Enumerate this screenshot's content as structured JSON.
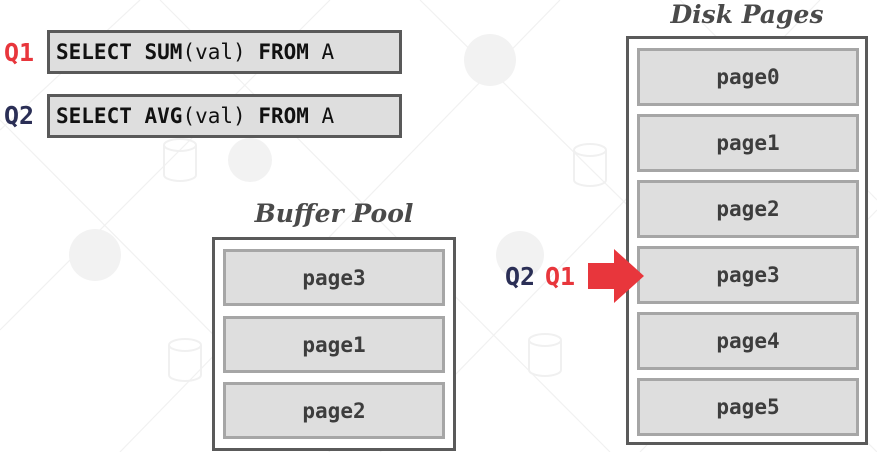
{
  "queries": [
    {
      "id": "Q1",
      "parts": [
        {
          "text": "SELECT",
          "bold": true
        },
        {
          "text": " "
        },
        {
          "text": "SUM",
          "bold": true
        },
        {
          "text": "(val) "
        },
        {
          "text": "FROM",
          "bold": true
        },
        {
          "text": " A"
        }
      ]
    },
    {
      "id": "Q2",
      "parts": [
        {
          "text": "SELECT",
          "bold": true
        },
        {
          "text": " "
        },
        {
          "text": "AVG",
          "bold": true
        },
        {
          "text": "(val) "
        },
        {
          "text": "FROM",
          "bold": true
        },
        {
          "text": " A"
        }
      ]
    }
  ],
  "buffer_pool": {
    "title": "Buffer Pool",
    "pages": [
      "page3",
      "page1",
      "page2"
    ]
  },
  "disk": {
    "title": "Disk Pages",
    "pages": [
      "page0",
      "page1",
      "page2",
      "page3",
      "page4",
      "page5"
    ]
  },
  "cursor": {
    "q2_label": "Q2",
    "q1_label": "Q1",
    "points_to": "page3"
  },
  "colors": {
    "q1": "#e8363c",
    "q2": "#2b2f56",
    "arrow": "#e8363c",
    "page_fill": "#dedede",
    "page_border": "#a6a6a6",
    "container_border": "#5a5a5a"
  }
}
